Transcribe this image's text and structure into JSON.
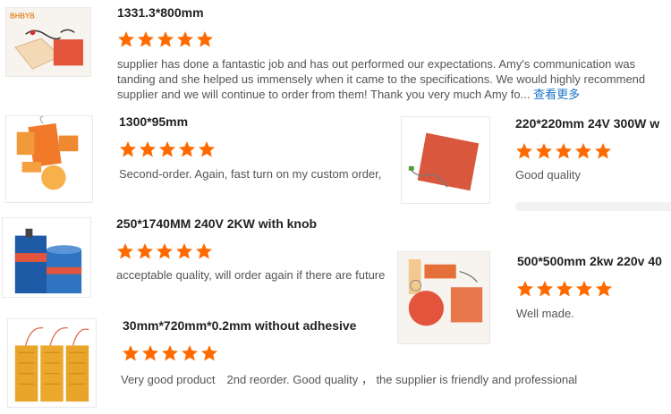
{
  "colors": {
    "star": "#ff6a00",
    "link": "#1a73c8"
  },
  "reviews": [
    {
      "title": "1331.3*800mm",
      "rating": 5,
      "lines": [
        "supplier has done a fantastic job and has out performed our expectations. Amy's communication was",
        "tanding and she helped us immensely when it came to the specifications. We would highly recommend",
        "supplier and we will continue to order from them! Thank you very much Amy fo..."
      ],
      "more": "查看更多",
      "thumb_logo": "BHBYB"
    },
    {
      "title": "1300*95mm",
      "rating": 5,
      "text": "Second-order. Again, fast turn on my custom order, "
    },
    {
      "title": "220*220mm 24V 300W w",
      "rating": 5,
      "text": "Good quality"
    },
    {
      "title": "250*1740MM 240V 2KW with knob",
      "rating": 5,
      "text": "acceptable quality, will order again if there are future"
    },
    {
      "title": "500*500mm 2kw 220v 40",
      "rating": 5,
      "text": "Well made."
    },
    {
      "title": "30mm*720mm*0.2mm without adhesive",
      "rating": 5,
      "text": "Very good product　2nd reorder.  Good quality ， the supplier is friendly and professional"
    }
  ]
}
